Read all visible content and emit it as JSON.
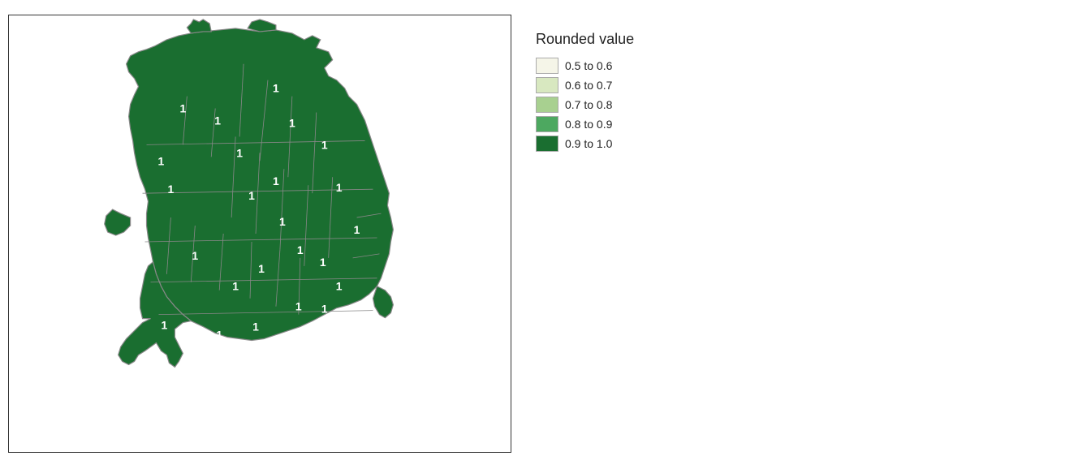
{
  "legend": {
    "title": "Rounded value",
    "items": [
      {
        "label": "0.5 to 0.6",
        "color": "#f5f5e8"
      },
      {
        "label": "0.6 to 0.7",
        "color": "#d8e8c0"
      },
      {
        "label": "0.7 to 0.8",
        "color": "#a8d090"
      },
      {
        "label": "0.8 to 0.9",
        "color": "#4da860"
      },
      {
        "label": "0.9 to 1.0",
        "color": "#1a6e30"
      }
    ]
  },
  "map": {
    "fill_color": "#1a6e30",
    "border_color": "#888888",
    "label": "1"
  }
}
